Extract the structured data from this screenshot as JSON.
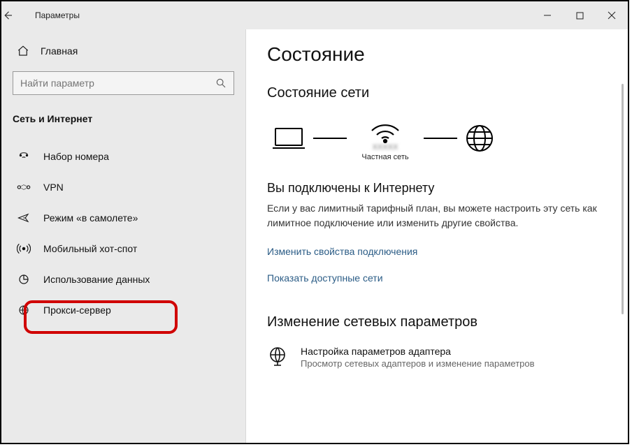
{
  "titlebar": {
    "title": "Параметры"
  },
  "sidebar": {
    "home": "Главная",
    "search_placeholder": "Найти параметр",
    "section": "Сеть и Интернет",
    "items": [
      {
        "icon": "dialup",
        "label": "Набор номера"
      },
      {
        "icon": "vpn",
        "label": "VPN"
      },
      {
        "icon": "airplane",
        "label": "Режим «в самолете»"
      },
      {
        "icon": "hotspot",
        "label": "Мобильный хот-спот"
      },
      {
        "icon": "data",
        "label": "Использование данных"
      },
      {
        "icon": "proxy",
        "label": "Прокси-сервер"
      }
    ]
  },
  "main": {
    "title": "Состояние",
    "status_heading": "Состояние сети",
    "diagram": {
      "network_name": "XXXXX",
      "network_type": "Частная сеть"
    },
    "connected_heading": "Вы подключены к Интернету",
    "connected_body": "Если у вас лимитный тарифный план, вы можете настроить эту сеть как лимитное подключение или изменить другие свойства.",
    "link_props": "Изменить свойства подключения",
    "link_networks": "Показать доступные сети",
    "change_heading": "Изменение сетевых параметров",
    "adapter_title": "Настройка параметров адаптера",
    "adapter_desc": "Просмотр сетевых адаптеров и изменение параметров"
  }
}
